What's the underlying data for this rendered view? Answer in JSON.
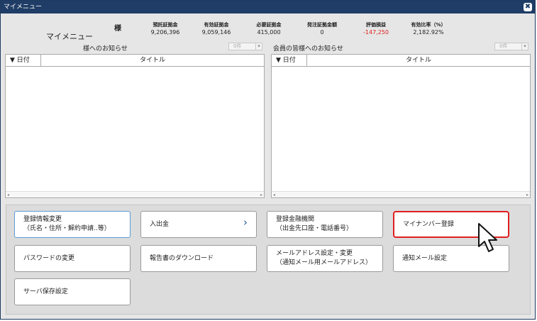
{
  "window": {
    "title": "マイメニュー",
    "close_glyph": "✖"
  },
  "account": {
    "menu_label": "マイメニュー",
    "sama": "様",
    "stats": [
      {
        "label": "預託証拠金",
        "value": "9,206,396",
        "negative": false
      },
      {
        "label": "有効証拠金",
        "value": "9,059,146",
        "negative": false
      },
      {
        "label": "必要証拠金",
        "value": "415,000",
        "negative": false
      },
      {
        "label": "発注証拠金額",
        "value": "0",
        "negative": false
      },
      {
        "label": "評価損益",
        "value": "-147,250",
        "negative": true
      },
      {
        "label": "有効比率（%）",
        "value": "2,182.92%",
        "negative": false
      }
    ]
  },
  "notices": {
    "personal": {
      "label": "様へのお知らせ",
      "count": "0件",
      "col_date": "▼ 日付",
      "col_title": "タイトル"
    },
    "members": {
      "label": "会員の皆様へのお知らせ",
      "count": "0件",
      "col_date": "▼ 日付",
      "col_title": "タイトル"
    }
  },
  "buttons": [
    {
      "id": "account-info",
      "label": "登録情報変更\n（氏名・住所・解約申請..等）"
    },
    {
      "id": "deposit-withdraw",
      "label": "入出金",
      "chevron": "›"
    },
    {
      "id": "bank-registration",
      "label": "登録金融機関\n（出金先口座・電話番号）"
    },
    {
      "id": "mynumber",
      "label": "マイナンバー登録"
    },
    {
      "id": "password",
      "label": "パスワードの変更"
    },
    {
      "id": "report-download",
      "label": "報告書のダウンロード"
    },
    {
      "id": "email-settings",
      "label": "メールアドレス設定・変更\n（通知メール用メールアドレス）"
    },
    {
      "id": "notify-mail",
      "label": "通知メール設定"
    },
    {
      "id": "server-save",
      "label": "サーバ保存設定"
    }
  ],
  "colors": {
    "titlebar": "#1f3d66",
    "negative": "#e02020",
    "highlight": "#e02020",
    "selected_border": "#5b9bd5"
  }
}
